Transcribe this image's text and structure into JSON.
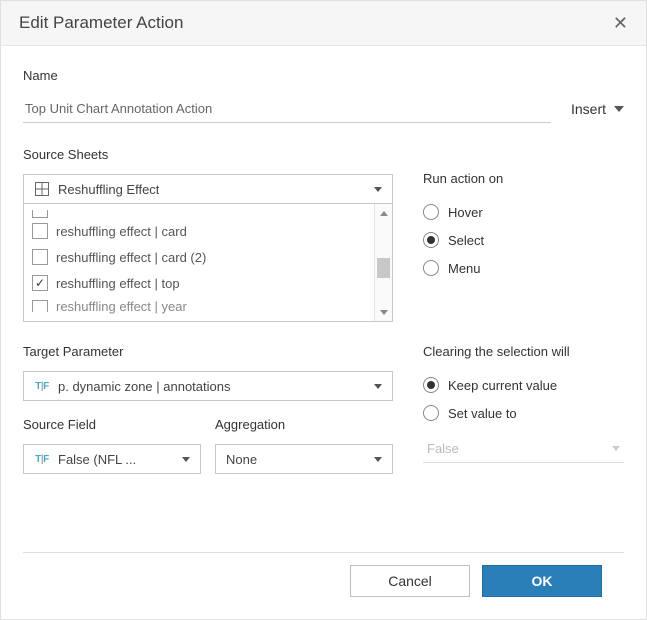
{
  "dialog": {
    "title": "Edit Parameter Action",
    "close_icon": "✕"
  },
  "name": {
    "label": "Name",
    "value": "Top Unit Chart Annotation Action",
    "insert_label": "Insert"
  },
  "source_sheets": {
    "label": "Source Sheets",
    "selected": "Reshuffling Effect",
    "items": [
      {
        "label": "reshuffling effect | card",
        "checked": false
      },
      {
        "label": "reshuffling effect | card (2)",
        "checked": false
      },
      {
        "label": "reshuffling effect | top",
        "checked": true
      }
    ],
    "partial_item": "reshuffling effect | year"
  },
  "run_action": {
    "label": "Run action on",
    "options": [
      "Hover",
      "Select",
      "Menu"
    ],
    "selected": "Select"
  },
  "target": {
    "label": "Target Parameter",
    "selected": "p. dynamic zone | annotations"
  },
  "clearing": {
    "label": "Clearing the selection will",
    "options": [
      "Keep current value",
      "Set value to"
    ],
    "selected": "Keep current value",
    "value_placeholder": "False"
  },
  "source_field": {
    "label": "Source Field",
    "selected": "False (NFL ..."
  },
  "aggregation": {
    "label": "Aggregation",
    "selected": "None"
  },
  "footer": {
    "cancel": "Cancel",
    "ok": "OK"
  }
}
